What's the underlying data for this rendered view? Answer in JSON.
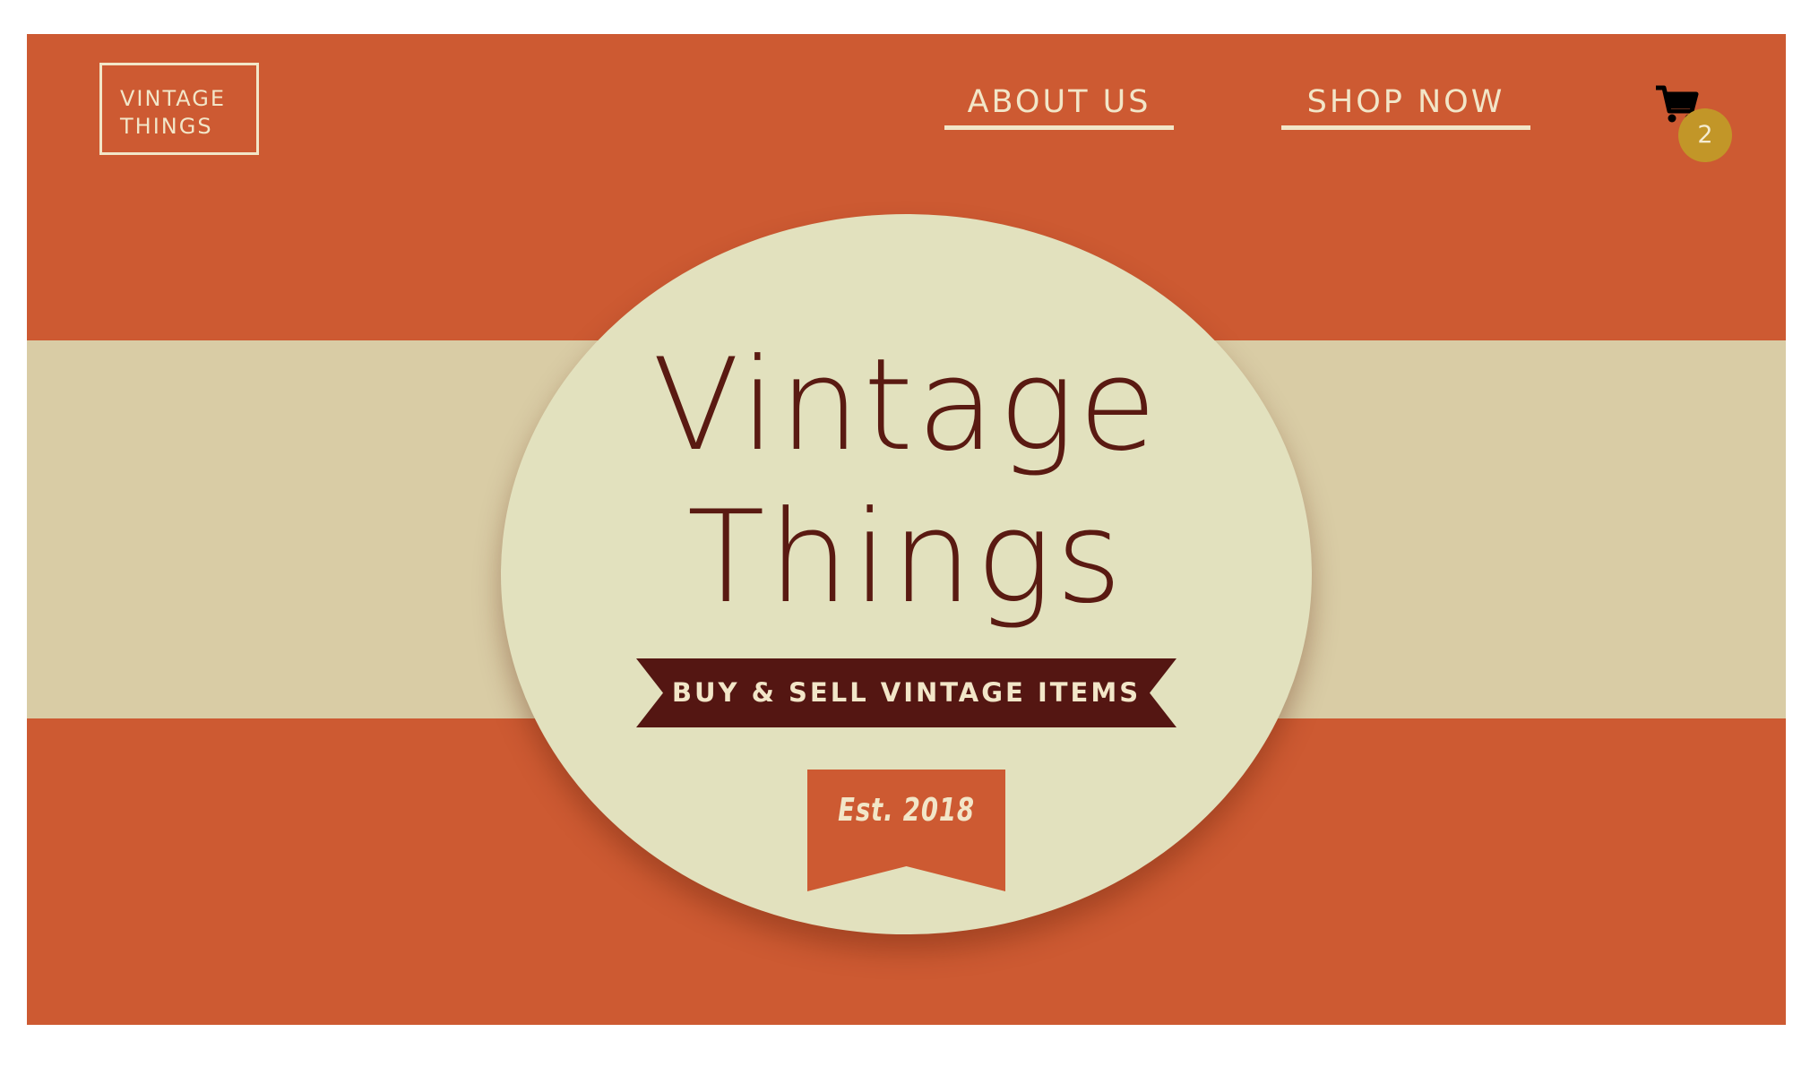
{
  "header": {
    "logo_line1": "VINTAGE",
    "logo_line2": "THINGS",
    "nav": {
      "about_label": "ABOUT US",
      "shop_label": "SHOP NOW"
    },
    "cart": {
      "icon": "shopping-cart-icon",
      "count": "2"
    }
  },
  "hero": {
    "title_line1": "Vintage",
    "title_line2": "Things",
    "tagline": "BUY & SELL VINTAGE ITEMS",
    "established": "Est. 2018"
  },
  "colors": {
    "brand_orange": "#cd5a32",
    "band_tan": "#d9cca5",
    "circle_cream": "#e2e1be",
    "text_maroon": "#5a1a12",
    "ribbon_maroon": "#541612",
    "badge_gold": "#c29628",
    "light_text": "#f2e6c8"
  }
}
